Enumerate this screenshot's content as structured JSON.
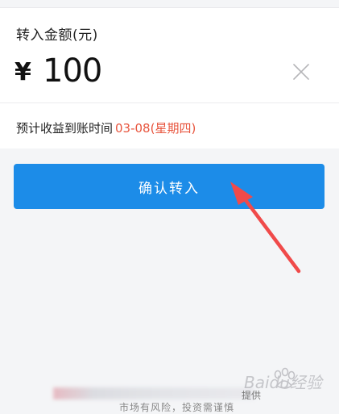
{
  "transfer": {
    "label": "转入金额(元)",
    "currency_symbol": "¥",
    "amount": "100",
    "clear_icon": "close-icon"
  },
  "arrival": {
    "prefix": "预计收益到账时间",
    "date": "03-08(星期四)"
  },
  "confirm_button": {
    "label": "确认转入"
  },
  "footer": {
    "provider_suffix": "提供",
    "risk_text": "市场有风险，投资需谨慎"
  },
  "watermark": {
    "brand": "Baidu经验",
    "icon": "paw-icon"
  },
  "colors": {
    "accent": "#1c8ce8",
    "date_highlight": "#e8553e",
    "annotation_arrow": "#f04a4a"
  }
}
